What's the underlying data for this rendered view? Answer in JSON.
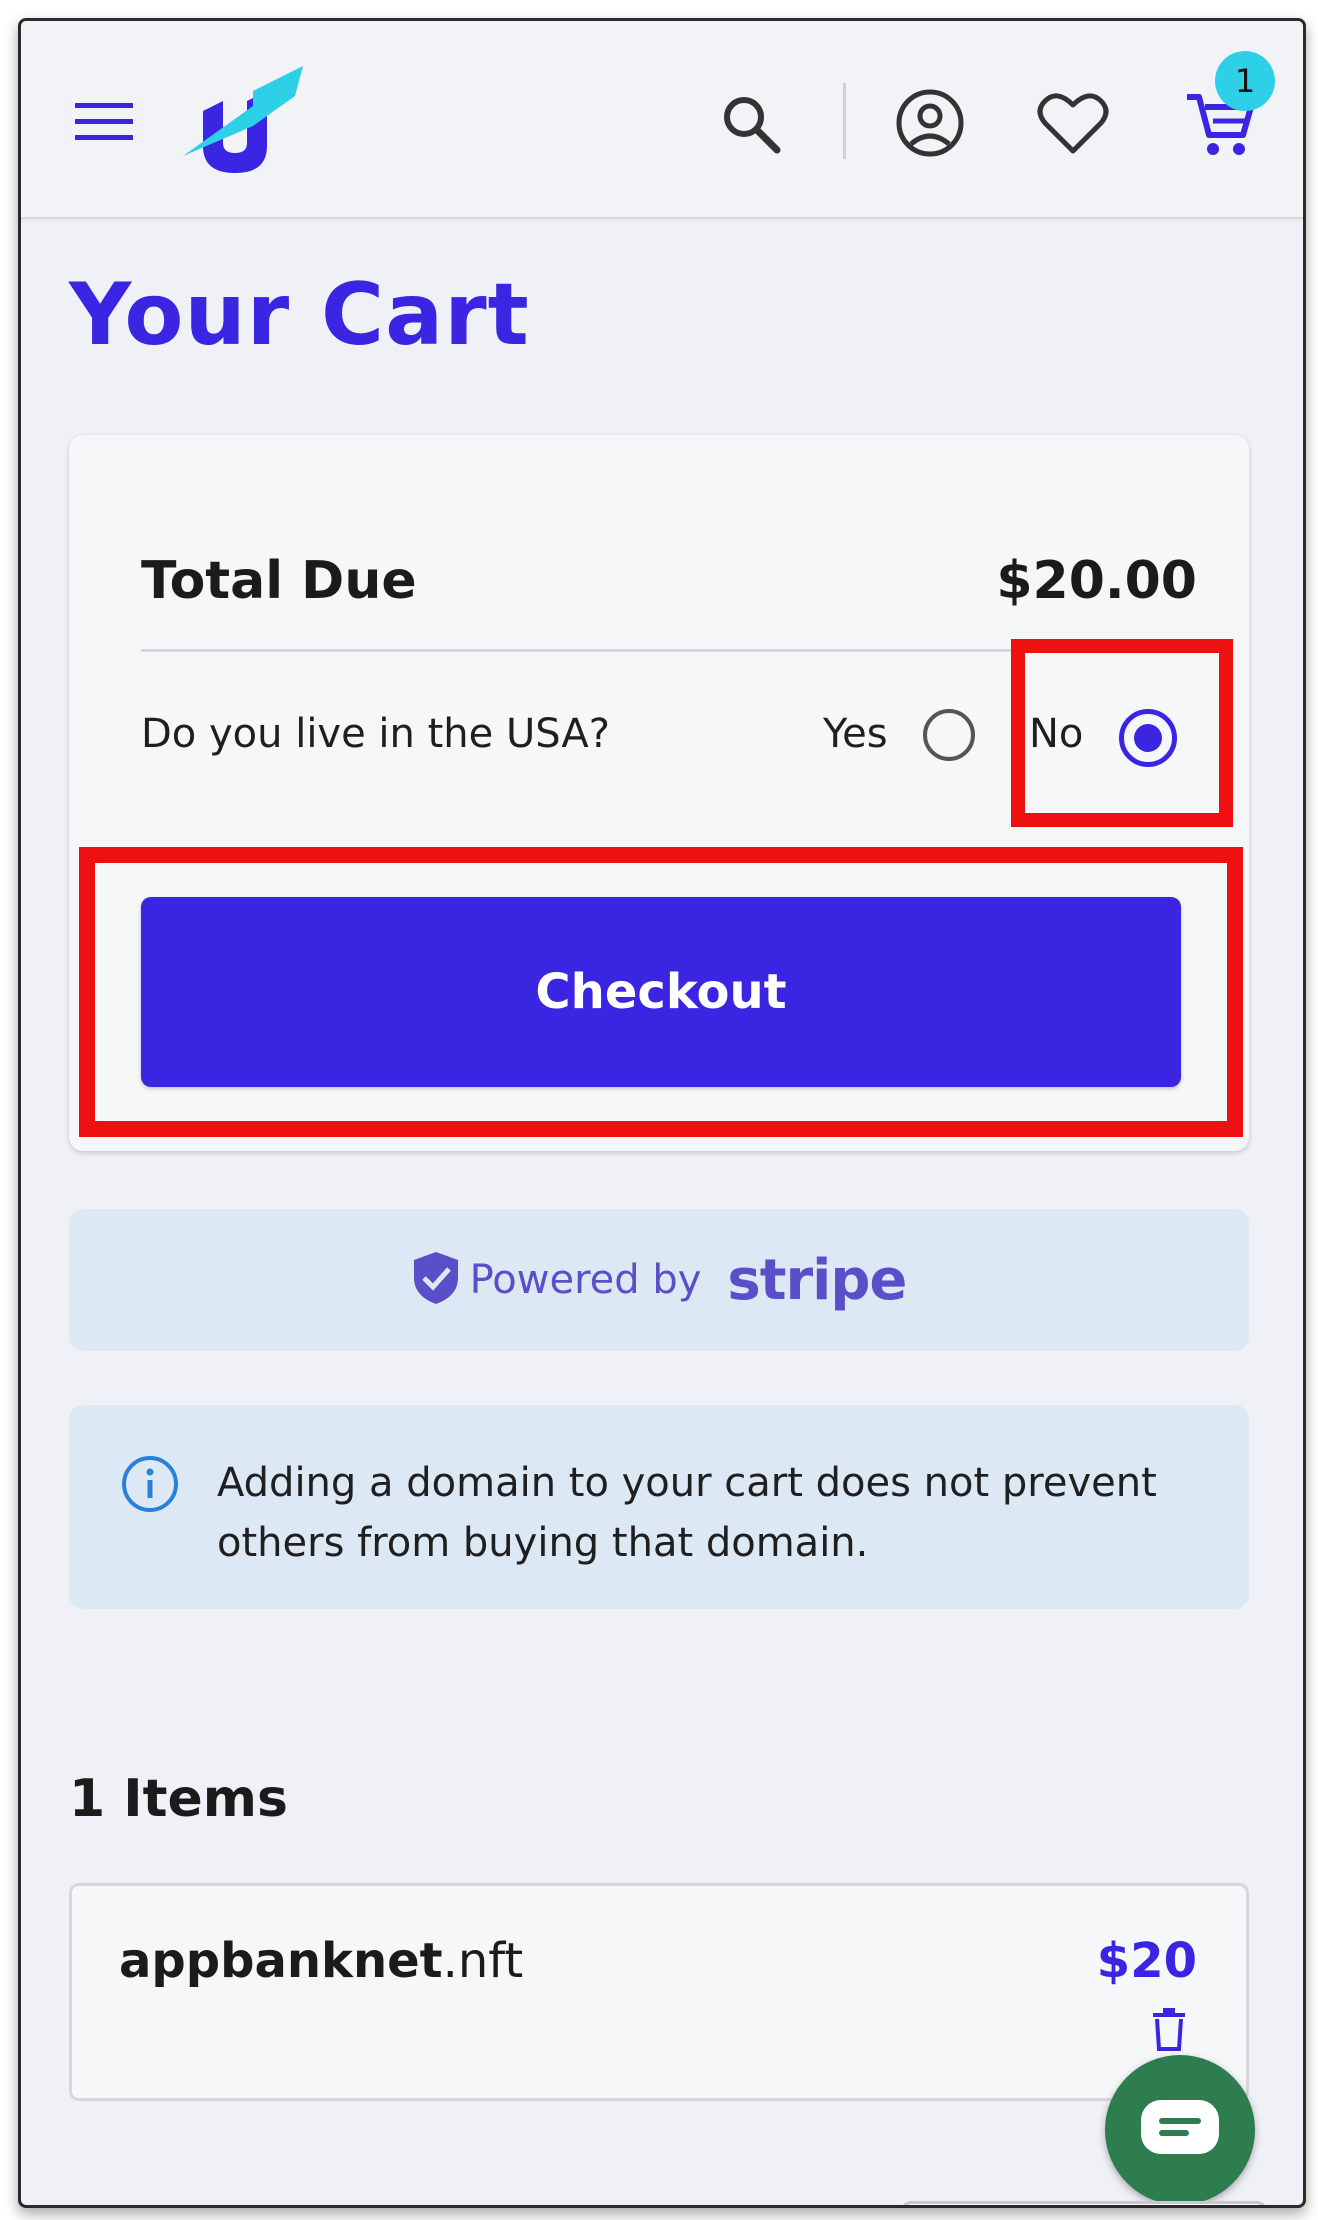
{
  "header": {
    "menu_icon": "hamburger-menu-icon",
    "logo_icon": "unstoppable-domains-logo",
    "search_icon": "search-icon",
    "account_icon": "account-circle-icon",
    "wishlist_icon": "heart-icon",
    "cart_icon": "shopping-cart-icon",
    "cart_count": "1"
  },
  "page": {
    "title": "Your Cart"
  },
  "summary": {
    "total_label": "Total Due",
    "total_value": "$20.00",
    "usa_question": "Do you live in the USA?",
    "yes_label": "Yes",
    "no_label": "No",
    "selected": "No",
    "checkout_label": "Checkout"
  },
  "stripe": {
    "icon": "shield-check-icon",
    "powered_by": "Powered by",
    "brand": "stripe"
  },
  "notice": {
    "icon": "info-icon",
    "text": "Adding a domain to your cart does not prevent others from buying that domain."
  },
  "items": {
    "heading": "1 Items",
    "list": [
      {
        "name_sld": "appbanknet",
        "name_tld": ".nft",
        "price": "$20",
        "delete_icon": "trash-icon"
      }
    ]
  },
  "chat": {
    "icon": "chat-bubble-icon"
  },
  "colors": {
    "brand": "#3a25e2",
    "highlight": "#ee1111",
    "badge": "#2ed0e8",
    "chat": "#2e7d4f",
    "banner": "#dce9f4"
  }
}
